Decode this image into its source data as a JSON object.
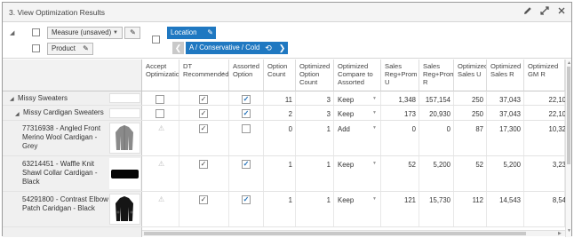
{
  "window": {
    "title": "3. View Optimization Results"
  },
  "pivot": {
    "measure_label": "Measure (unsaved)",
    "product_label": "Product",
    "location_label": "Location",
    "nav_label": "A / Conservative / Cold"
  },
  "columns": [
    {
      "label": "Accept Optimizatio"
    },
    {
      "label": "DT Recommended"
    },
    {
      "label": "Assorted Option"
    },
    {
      "label": "Option Count"
    },
    {
      "label": "Optimized Option Count"
    },
    {
      "label": "Optimized Compare to Assorted"
    },
    {
      "label": "Sales Reg+Prom U"
    },
    {
      "label": "Sales Reg+Prom R"
    },
    {
      "label": "Optimized Sales U"
    },
    {
      "label": "Optimized Sales R"
    },
    {
      "label": "Optimized GM R"
    }
  ],
  "rows": [
    {
      "label": "Missy Sweaters",
      "cells": {
        "option_count": "11",
        "opt_option_count": "3",
        "compare": "Keep",
        "sales_u": "1,348",
        "sales_r": "157,154",
        "opt_sales_u": "250",
        "opt_sales_r": "37,043",
        "opt_gm_r": "22,10"
      }
    },
    {
      "label": "Missy Cardigan Sweaters",
      "cells": {
        "option_count": "2",
        "opt_option_count": "3",
        "compare": "Keep",
        "sales_u": "173",
        "sales_r": "20,930",
        "opt_sales_u": "250",
        "opt_sales_r": "37,043",
        "opt_gm_r": "22,10"
      }
    },
    {
      "label_lines": [
        "77316938 - Angled Front",
        "Merino Wool Cardigan -",
        "Grey"
      ],
      "cells": {
        "option_count": "0",
        "opt_option_count": "1",
        "compare": "Add",
        "sales_u": "0",
        "sales_r": "0",
        "opt_sales_u": "87",
        "opt_sales_r": "17,300",
        "opt_gm_r": "10,32"
      }
    },
    {
      "label_lines": [
        "63214451 - Waffle Knit",
        "Shawl Collar Cardigan -",
        "Black"
      ],
      "cells": {
        "option_count": "1",
        "opt_option_count": "1",
        "compare": "Keep",
        "sales_u": "52",
        "sales_r": "5,200",
        "opt_sales_u": "52",
        "opt_sales_r": "5,200",
        "opt_gm_r": "3,23"
      }
    },
    {
      "label_lines": [
        "54291800 - Contrast Elbow",
        "Patch Caridgan - Black"
      ],
      "cells": {
        "option_count": "1",
        "opt_option_count": "1",
        "compare": "Keep",
        "sales_u": "121",
        "sales_r": "15,730",
        "opt_sales_u": "112",
        "opt_sales_r": "14,543",
        "opt_gm_r": "8,54"
      }
    }
  ],
  "icons": {
    "edit": "pencil-icon",
    "expand": "expand-icon",
    "close": "close-icon"
  },
  "colors": {
    "accent": "#1f78c1",
    "header_bg": "#f4f4f4"
  }
}
